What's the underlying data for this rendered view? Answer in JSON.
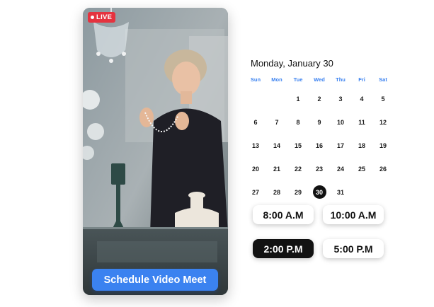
{
  "video": {
    "live_label": "LIVE",
    "cta_label": "Schedule Video Meet"
  },
  "calendar": {
    "title": "Monday, January 30",
    "weekdays": [
      "Sun",
      "Mon",
      "Tue",
      "Wed",
      "Thu",
      "Fri",
      "Sat"
    ],
    "leading_blanks": 2,
    "days": [
      "1",
      "2",
      "3",
      "4",
      "5",
      "6",
      "7",
      "8",
      "9",
      "10",
      "11",
      "12",
      "13",
      "14",
      "15",
      "16",
      "17",
      "18",
      "19",
      "20",
      "21",
      "22",
      "23",
      "24",
      "25",
      "26",
      "27",
      "28",
      "29",
      "30",
      "31"
    ],
    "selected_day": "30"
  },
  "time_slots": [
    {
      "label": "8:00 A.M",
      "selected": false
    },
    {
      "label": "10:00 A.M",
      "selected": false
    },
    {
      "label": "2:00 P.M",
      "selected": true
    },
    {
      "label": "5:00 P.M",
      "selected": false
    }
  ],
  "colors": {
    "accent_blue": "#3b82f0",
    "live_red": "#e5333f",
    "selected_dark": "#121212"
  }
}
